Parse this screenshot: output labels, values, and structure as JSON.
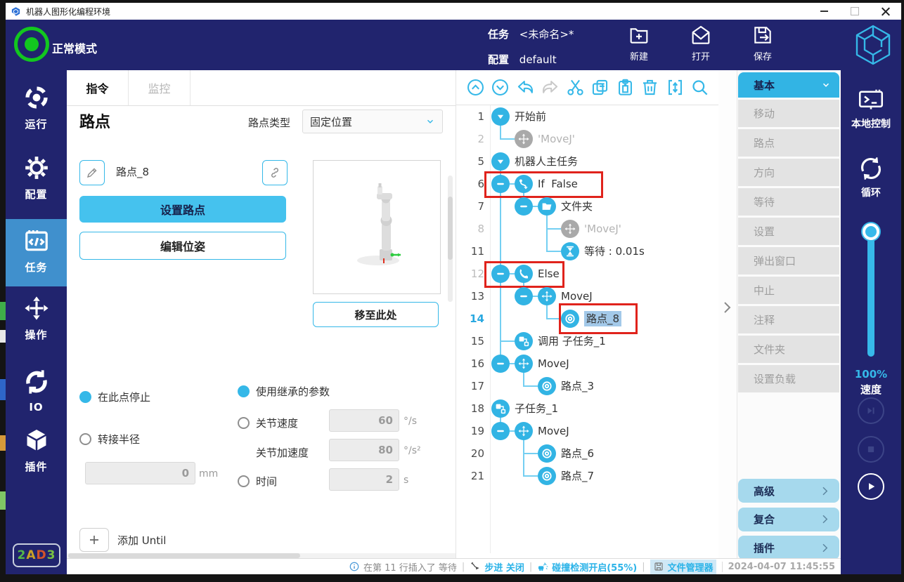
{
  "colors": {
    "accent": "#35b8e8",
    "navy": "#21246e",
    "sidebar_active": "#4090cd",
    "annotation_red": "#e0231c",
    "group_blue": "#a6d9ed",
    "selection_blue": "#a3c9e9"
  },
  "window": {
    "title": "机器人图形化编程环境"
  },
  "header": {
    "mode_label": "正常模式",
    "task_label": "任务",
    "task_value": "<未命名>*",
    "config_label": "配置",
    "config_value": "default",
    "actions": [
      {
        "icon": "new-task-icon",
        "label": "新建"
      },
      {
        "icon": "open-task-icon",
        "label": "打开"
      },
      {
        "icon": "save-task-icon",
        "label": "保存"
      }
    ]
  },
  "sidebar": {
    "items": [
      {
        "icon": "run-icon",
        "label": "运行",
        "active": false
      },
      {
        "icon": "config-icon",
        "label": "配置",
        "active": false
      },
      {
        "icon": "task-icon",
        "label": "任务",
        "active": true
      },
      {
        "icon": "operate-icon",
        "label": "操作",
        "active": false
      },
      {
        "icon": "io-icon",
        "label": "IO",
        "active": false
      },
      {
        "icon": "plugin-icon",
        "label": "插件",
        "active": false
      }
    ],
    "badge": {
      "text": "2AD3",
      "letter_colors": [
        "#54b948",
        "#c9a227",
        "#d4542a",
        "#7ac143"
      ]
    }
  },
  "editor": {
    "tabs": [
      {
        "label": "指令",
        "active": true
      },
      {
        "label": "监控",
        "active": false
      }
    ],
    "title": "路点",
    "type_label": "路点类型",
    "type_value": "固定位置",
    "name_field": {
      "value": "路点_8"
    },
    "buttons": {
      "set_waypoint": "设置路点",
      "edit_pose": "编辑位姿",
      "move_here": "移至此处"
    },
    "stop_group": {
      "stop_at_point": {
        "label": "在此点停止",
        "selected": true
      },
      "blend_radius": {
        "label": "转接半径",
        "selected": false,
        "value": "0",
        "unit": "mm"
      }
    },
    "param_group": {
      "inherit": {
        "label": "使用继承的参数",
        "selected": true
      },
      "joint_speed": {
        "label": "关节速度",
        "selected": false,
        "value": "60",
        "unit": "°/s"
      },
      "joint_acc": {
        "label": "关节加速度",
        "value": "80",
        "unit": "°/s²"
      },
      "time": {
        "label": "时间",
        "selected": false,
        "value": "2",
        "unit": "s"
      }
    },
    "add_until_label": "添加 Until"
  },
  "tree_toolbar": [
    {
      "icon": "collapse-up-icon",
      "disabled": false
    },
    {
      "icon": "collapse-down-icon",
      "disabled": false
    },
    {
      "icon": "undo-icon",
      "disabled": false
    },
    {
      "icon": "redo-icon",
      "disabled": true
    },
    {
      "icon": "cut-icon",
      "disabled": false
    },
    {
      "icon": "copy-icon",
      "disabled": false
    },
    {
      "icon": "paste-icon",
      "disabled": false
    },
    {
      "icon": "delete-icon",
      "disabled": false
    },
    {
      "icon": "insert-icon",
      "disabled": false
    },
    {
      "icon": "search-icon",
      "disabled": false
    }
  ],
  "tree": {
    "rows": [
      {
        "num": "1",
        "col": 0,
        "minus": false,
        "icon": "caret-down-icon",
        "text": "开始前"
      },
      {
        "num": "2",
        "col": 1,
        "minus": false,
        "icon": "movej-icon",
        "text": "'MoveJ'",
        "dim": true,
        "num_dim": true
      },
      {
        "num": "5",
        "col": 0,
        "minus": false,
        "icon": "caret-down-icon",
        "text": "机器人主任务"
      },
      {
        "num": "6",
        "col": 0,
        "minus": true,
        "icon": "if-icon",
        "text": "If  False",
        "annotated": true
      },
      {
        "num": "7",
        "col": 1,
        "minus": true,
        "icon": "folder-icon",
        "text": "文件夹"
      },
      {
        "num": "8",
        "col": 3,
        "minus": false,
        "icon": "movej-icon",
        "text": "'MoveJ'",
        "dim": true,
        "num_dim": true
      },
      {
        "num": "11",
        "col": 3,
        "minus": false,
        "icon": "wait-icon",
        "text": "等待 : 0.01s"
      },
      {
        "num": "12",
        "col": 0,
        "minus": true,
        "icon": "else-icon",
        "text": "Else",
        "num_dim": true,
        "annotated": true
      },
      {
        "num": "13",
        "col": 1,
        "minus": true,
        "icon": "movej-icon",
        "text": "MoveJ"
      },
      {
        "num": "14",
        "col": 3,
        "minus": false,
        "icon": "waypoint-icon",
        "text": "路点_8",
        "selected": true,
        "num_active": true,
        "annotated": true
      },
      {
        "num": "15",
        "col": 1,
        "minus": false,
        "icon": "subtask-icon",
        "text": "调用 子任务_1"
      },
      {
        "num": "16",
        "col": 0,
        "minus": true,
        "icon": "movej-icon",
        "text": "MoveJ"
      },
      {
        "num": "17",
        "col": 2,
        "minus": false,
        "icon": "waypoint-icon",
        "text": "路点_3"
      },
      {
        "num": "18",
        "col": 0,
        "minus": false,
        "icon": "subtask-icon",
        "text": "子任务_1"
      },
      {
        "num": "19",
        "col": 0,
        "minus": true,
        "icon": "movej-icon",
        "text": "MoveJ"
      },
      {
        "num": "20",
        "col": 2,
        "minus": false,
        "icon": "waypoint-icon",
        "text": "路点_6"
      },
      {
        "num": "21",
        "col": 2,
        "minus": false,
        "icon": "waypoint-icon",
        "text": "路点_7"
      }
    ]
  },
  "palette": {
    "header_label": "基本",
    "items": [
      "移动",
      "路点",
      "方向",
      "等待",
      "设置",
      "弹出窗口",
      "中止",
      "注释",
      "文件夹",
      "设置负载"
    ],
    "groups": [
      "高级",
      "复合",
      "插件"
    ]
  },
  "rightbar": {
    "local_control": {
      "icon": "terminal-icon",
      "label": "本地控制"
    },
    "loop": {
      "icon": "loop-icon",
      "label": "循环"
    },
    "speed": {
      "value": "100%",
      "label": "速度"
    },
    "transport": [
      {
        "icon": "step-forward-icon",
        "enabled": false
      },
      {
        "icon": "stop-icon",
        "enabled": false
      },
      {
        "icon": "play-icon",
        "enabled": true
      }
    ]
  },
  "statusbar": {
    "message": {
      "icon": "info-icon",
      "text": "在第 11 行插入了 等待"
    },
    "step": {
      "icon": "step-status-icon",
      "text": "步进 关闭"
    },
    "collision": {
      "icon": "collision-icon",
      "text": "碰撞检测开启(55%)"
    },
    "file_manager": {
      "icon": "disk-icon",
      "text": "文件管理器"
    },
    "datetime": "2024-04-07 11:45:55"
  }
}
